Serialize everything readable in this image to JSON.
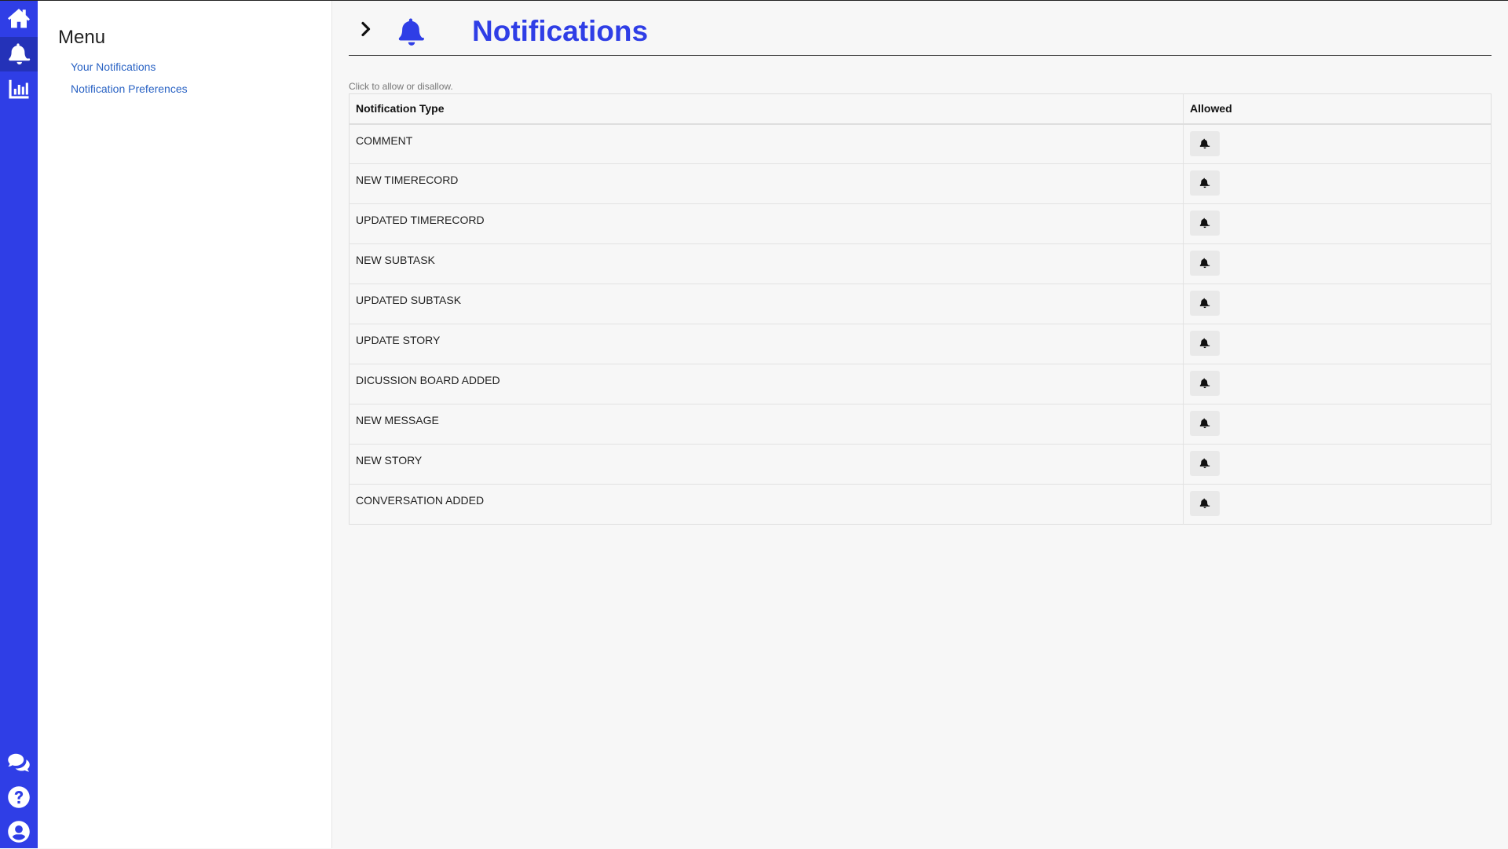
{
  "rail": {
    "items": [
      {
        "name": "home-icon"
      },
      {
        "name": "bell-icon"
      },
      {
        "name": "chart-icon"
      }
    ],
    "bottom_items": [
      {
        "name": "chat-icon"
      },
      {
        "name": "help-icon"
      },
      {
        "name": "user-icon"
      }
    ],
    "color": "#2f3ee6",
    "active_color": "#2432b8"
  },
  "menu": {
    "title": "Menu",
    "links": [
      "Your Notifications",
      "Notification Preferences"
    ]
  },
  "header": {
    "title": "Notifications",
    "title_color": "#2f3ee6"
  },
  "hint": "Click to allow or disallow.",
  "table": {
    "columns": [
      "Notification Type",
      "Allowed"
    ],
    "rows": [
      {
        "type": "COMMENT"
      },
      {
        "type": "NEW TIMERECORD"
      },
      {
        "type": "UPDATED TIMERECORD"
      },
      {
        "type": "NEW SUBTASK"
      },
      {
        "type": "UPDATED SUBTASK"
      },
      {
        "type": "UPDATE STORY"
      },
      {
        "type": "DICUSSION BOARD ADDED"
      },
      {
        "type": "NEW MESSAGE"
      },
      {
        "type": "NEW STORY"
      },
      {
        "type": "CONVERSATION ADDED"
      }
    ]
  }
}
